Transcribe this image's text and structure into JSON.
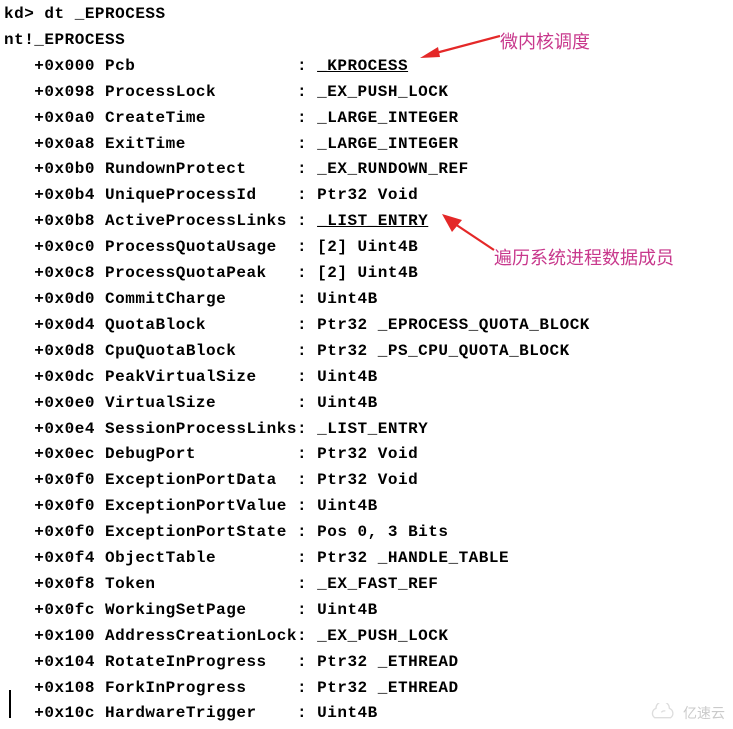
{
  "prompt": "kd> dt _EPROCESS",
  "struct_header": "nt!_EPROCESS",
  "annotations": {
    "a1": "微内核调度",
    "a2": "遍历系统进程数据成员"
  },
  "watermark": "亿速云",
  "rows": [
    {
      "off": "+0x000",
      "name": "Pcb",
      "sep": ":",
      "type": "_KPROCESS",
      "u": true
    },
    {
      "off": "+0x098",
      "name": "ProcessLock",
      "sep": ":",
      "type": "_EX_PUSH_LOCK"
    },
    {
      "off": "+0x0a0",
      "name": "CreateTime",
      "sep": ":",
      "type": "_LARGE_INTEGER"
    },
    {
      "off": "+0x0a8",
      "name": "ExitTime",
      "sep": ":",
      "type": "_LARGE_INTEGER"
    },
    {
      "off": "+0x0b0",
      "name": "RundownProtect",
      "sep": ":",
      "type": "_EX_RUNDOWN_REF"
    },
    {
      "off": "+0x0b4",
      "name": "UniqueProcessId",
      "sep": ":",
      "type": "Ptr32 Void"
    },
    {
      "off": "+0x0b8",
      "name": "ActiveProcessLinks",
      "sep": ":",
      "type": "_LIST_ENTRY",
      "u": true
    },
    {
      "off": "+0x0c0",
      "name": "ProcessQuotaUsage",
      "sep": ":",
      "type": "[2] Uint4B"
    },
    {
      "off": "+0x0c8",
      "name": "ProcessQuotaPeak",
      "sep": ":",
      "type": "[2] Uint4B"
    },
    {
      "off": "+0x0d0",
      "name": "CommitCharge",
      "sep": ":",
      "type": "Uint4B"
    },
    {
      "off": "+0x0d4",
      "name": "QuotaBlock",
      "sep": ":",
      "type": "Ptr32 _EPROCESS_QUOTA_BLOCK"
    },
    {
      "off": "+0x0d8",
      "name": "CpuQuotaBlock",
      "sep": ":",
      "type": "Ptr32 _PS_CPU_QUOTA_BLOCK"
    },
    {
      "off": "+0x0dc",
      "name": "PeakVirtualSize",
      "sep": ":",
      "type": "Uint4B"
    },
    {
      "off": "+0x0e0",
      "name": "VirtualSize",
      "sep": ":",
      "type": "Uint4B"
    },
    {
      "off": "+0x0e4",
      "name": "SessionProcessLinks",
      "sep": ":",
      "type": "_LIST_ENTRY"
    },
    {
      "off": "+0x0ec",
      "name": "DebugPort",
      "sep": ":",
      "type": "Ptr32 Void"
    },
    {
      "off": "+0x0f0",
      "name": "ExceptionPortData",
      "sep": ":",
      "type": "Ptr32 Void"
    },
    {
      "off": "+0x0f0",
      "name": "ExceptionPortValue",
      "sep": ":",
      "type": "Uint4B"
    },
    {
      "off": "+0x0f0",
      "name": "ExceptionPortState",
      "sep": ":",
      "type": "Pos 0, 3 Bits"
    },
    {
      "off": "+0x0f4",
      "name": "ObjectTable",
      "sep": ":",
      "type": "Ptr32 _HANDLE_TABLE"
    },
    {
      "off": "+0x0f8",
      "name": "Token",
      "sep": ":",
      "type": "_EX_FAST_REF"
    },
    {
      "off": "+0x0fc",
      "name": "WorkingSetPage",
      "sep": ":",
      "type": "Uint4B"
    },
    {
      "off": "+0x100",
      "name": "AddressCreationLock",
      "sep": ":",
      "type": "_EX_PUSH_LOCK"
    },
    {
      "off": "+0x104",
      "name": "RotateInProgress",
      "sep": ":",
      "type": "Ptr32 _ETHREAD"
    },
    {
      "off": "+0x108",
      "name": "ForkInProgress",
      "sep": ":",
      "type": "Ptr32 _ETHREAD"
    },
    {
      "off": "+0x10c",
      "name": "HardwareTrigger",
      "sep": ":",
      "type": "Uint4B"
    }
  ]
}
